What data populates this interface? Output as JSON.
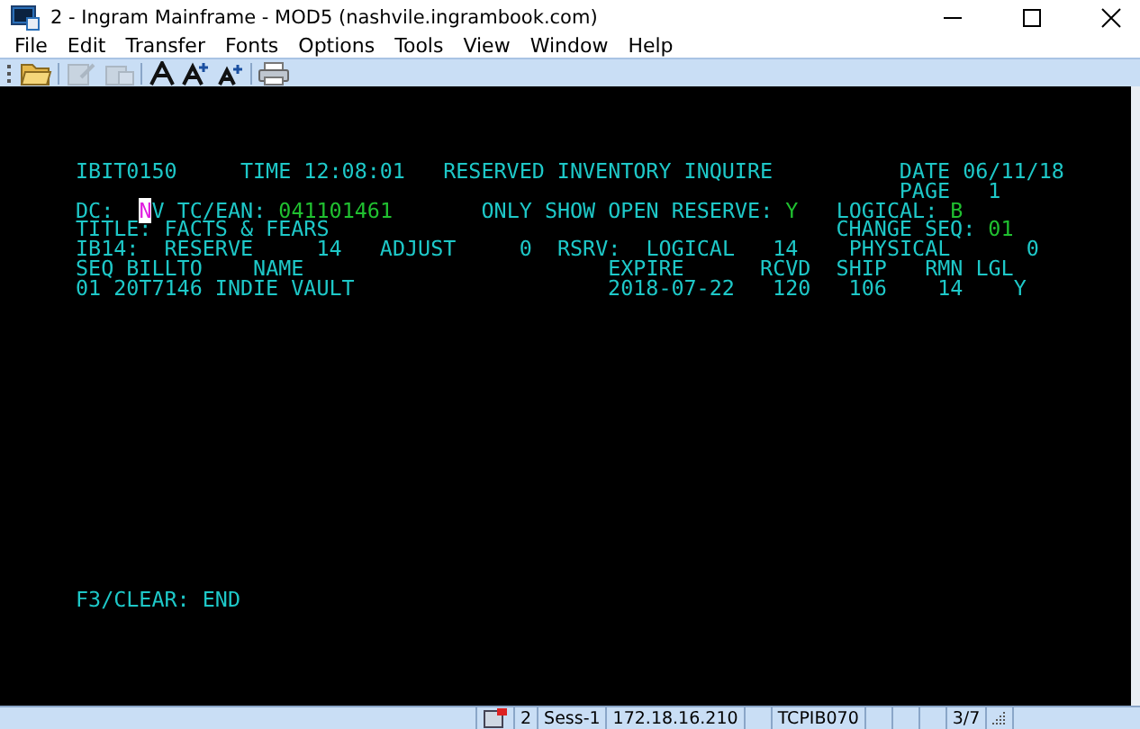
{
  "window": {
    "title": "2 - Ingram Mainframe - MOD5 (nashvile.ingrambook.com)"
  },
  "menu": [
    "File",
    "Edit",
    "Transfer",
    "Fonts",
    "Options",
    "Tools",
    "View",
    "Window",
    "Help"
  ],
  "toolbar": [
    {
      "kind": "folder",
      "disabled": false
    },
    {
      "kind": "edit",
      "disabled": true
    },
    {
      "kind": "paste",
      "disabled": true
    },
    {
      "kind": "font",
      "disabled": false
    },
    {
      "kind": "font-up",
      "disabled": false
    },
    {
      "kind": "font-down",
      "disabled": false
    },
    {
      "kind": "print",
      "disabled": false
    }
  ],
  "screen": {
    "lines": [
      {
        "segments": [
          {
            "text": "IBIT0150",
            "kind": "text"
          },
          {
            "text": "     TIME 12:08:01",
            "kind": "text"
          },
          {
            "text": "   RESERVED INVENTORY INQUIRE",
            "kind": "text"
          },
          {
            "text": "          DATE 06/11/18",
            "kind": "text"
          }
        ]
      },
      {
        "segments": [
          {
            "text": "                                                                 PAGE",
            "kind": "text"
          },
          {
            "text": "   1",
            "kind": "text"
          }
        ]
      },
      {
        "segments": [
          {
            "text": "DC:",
            "kind": "text"
          },
          {
            "text": "  N",
            "kind": "cursor"
          },
          {
            "text": "V",
            "kind": "text"
          },
          {
            "text": " TC/EAN:",
            "kind": "text"
          },
          {
            "text": " 041101461",
            "kind": "value"
          },
          {
            "text": "       ONLY SHOW OPEN RESERVE:",
            "kind": "text"
          },
          {
            "text": " Y",
            "kind": "value"
          },
          {
            "text": "   LOGICAL:",
            "kind": "text"
          },
          {
            "text": " B",
            "kind": "value"
          }
        ]
      },
      {
        "segments": [
          {
            "text": "TITLE: FACTS & FEARS",
            "kind": "text"
          },
          {
            "text": "                                        CHANGE SEQ:",
            "kind": "text"
          },
          {
            "text": " 01",
            "kind": "value"
          }
        ]
      },
      {
        "segments": [
          {
            "text": "IB14:",
            "kind": "text"
          },
          {
            "text": "  RESERVE",
            "kind": "text"
          },
          {
            "text": "     14",
            "kind": "text"
          },
          {
            "text": "   ADJUST",
            "kind": "text"
          },
          {
            "text": "     0",
            "kind": "text"
          },
          {
            "text": "  RSRV:",
            "kind": "text"
          },
          {
            "text": "  LOGICAL",
            "kind": "text"
          },
          {
            "text": "   14",
            "kind": "text"
          },
          {
            "text": "    PHYSICAL",
            "kind": "text"
          },
          {
            "text": "      0",
            "kind": "text"
          }
        ]
      },
      {
        "segments": [
          {
            "text": "SEQ BILLTO",
            "kind": "text"
          },
          {
            "text": "    NAME",
            "kind": "text"
          },
          {
            "text": "                        EXPIRE",
            "kind": "text"
          },
          {
            "text": "      RCVD",
            "kind": "text"
          },
          {
            "text": "  SHIP",
            "kind": "text"
          },
          {
            "text": "   RMN",
            "kind": "text"
          },
          {
            "text": " LGL",
            "kind": "text"
          }
        ]
      },
      {
        "segments": [
          {
            "text": "01 20T7146 INDIE VAULT",
            "kind": "text"
          },
          {
            "text": "                    2018-07-22",
            "kind": "text"
          },
          {
            "text": "   120",
            "kind": "text"
          },
          {
            "text": "   106",
            "kind": "text"
          },
          {
            "text": "    14",
            "kind": "text"
          },
          {
            "text": "    Y",
            "kind": "text"
          }
        ]
      }
    ],
    "footer": "F3/CLEAR: END"
  },
  "status_bar": [
    {
      "kind": "icon"
    },
    {
      "kind": "text",
      "text": "2"
    },
    {
      "kind": "text",
      "text": "Sess-1"
    },
    {
      "kind": "text",
      "text": "172.18.16.210"
    },
    {
      "kind": "empty"
    },
    {
      "kind": "text",
      "text": "TCPIB070"
    },
    {
      "kind": "empty"
    },
    {
      "kind": "empty"
    },
    {
      "kind": "empty"
    },
    {
      "kind": "text",
      "text": "3/7"
    }
  ]
}
